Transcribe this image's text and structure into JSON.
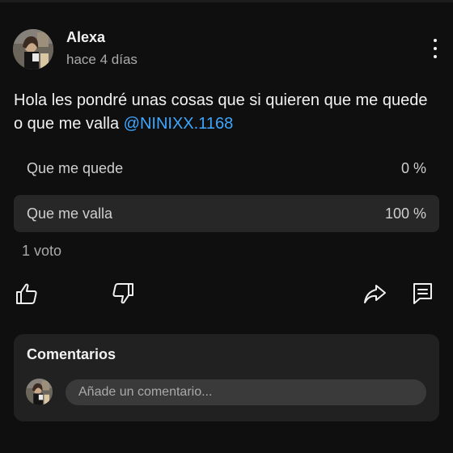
{
  "post": {
    "author": "Alexa",
    "time": "hace 4 días",
    "text": "Hola les pondré unas cosas que si quieren que me quede o que me valla ",
    "mention": "@NINIXX.1168"
  },
  "poll": {
    "options": [
      {
        "label": "Que me quede",
        "percent": "0 %"
      },
      {
        "label": "Que me valla",
        "percent": "100 %"
      }
    ],
    "votes": "1 voto"
  },
  "actions": {
    "like_icon": "thumbs-up-icon",
    "dislike_icon": "thumbs-down-icon",
    "share_icon": "share-icon",
    "comment_icon": "comment-icon"
  },
  "comments": {
    "title": "Comentarios",
    "placeholder": "Añade un comentario..."
  },
  "colors": {
    "background": "#0f0f0f",
    "card": "#212121",
    "selected_option": "#272727",
    "mention": "#3ea6ff",
    "secondary_text": "#aaaaaa"
  }
}
